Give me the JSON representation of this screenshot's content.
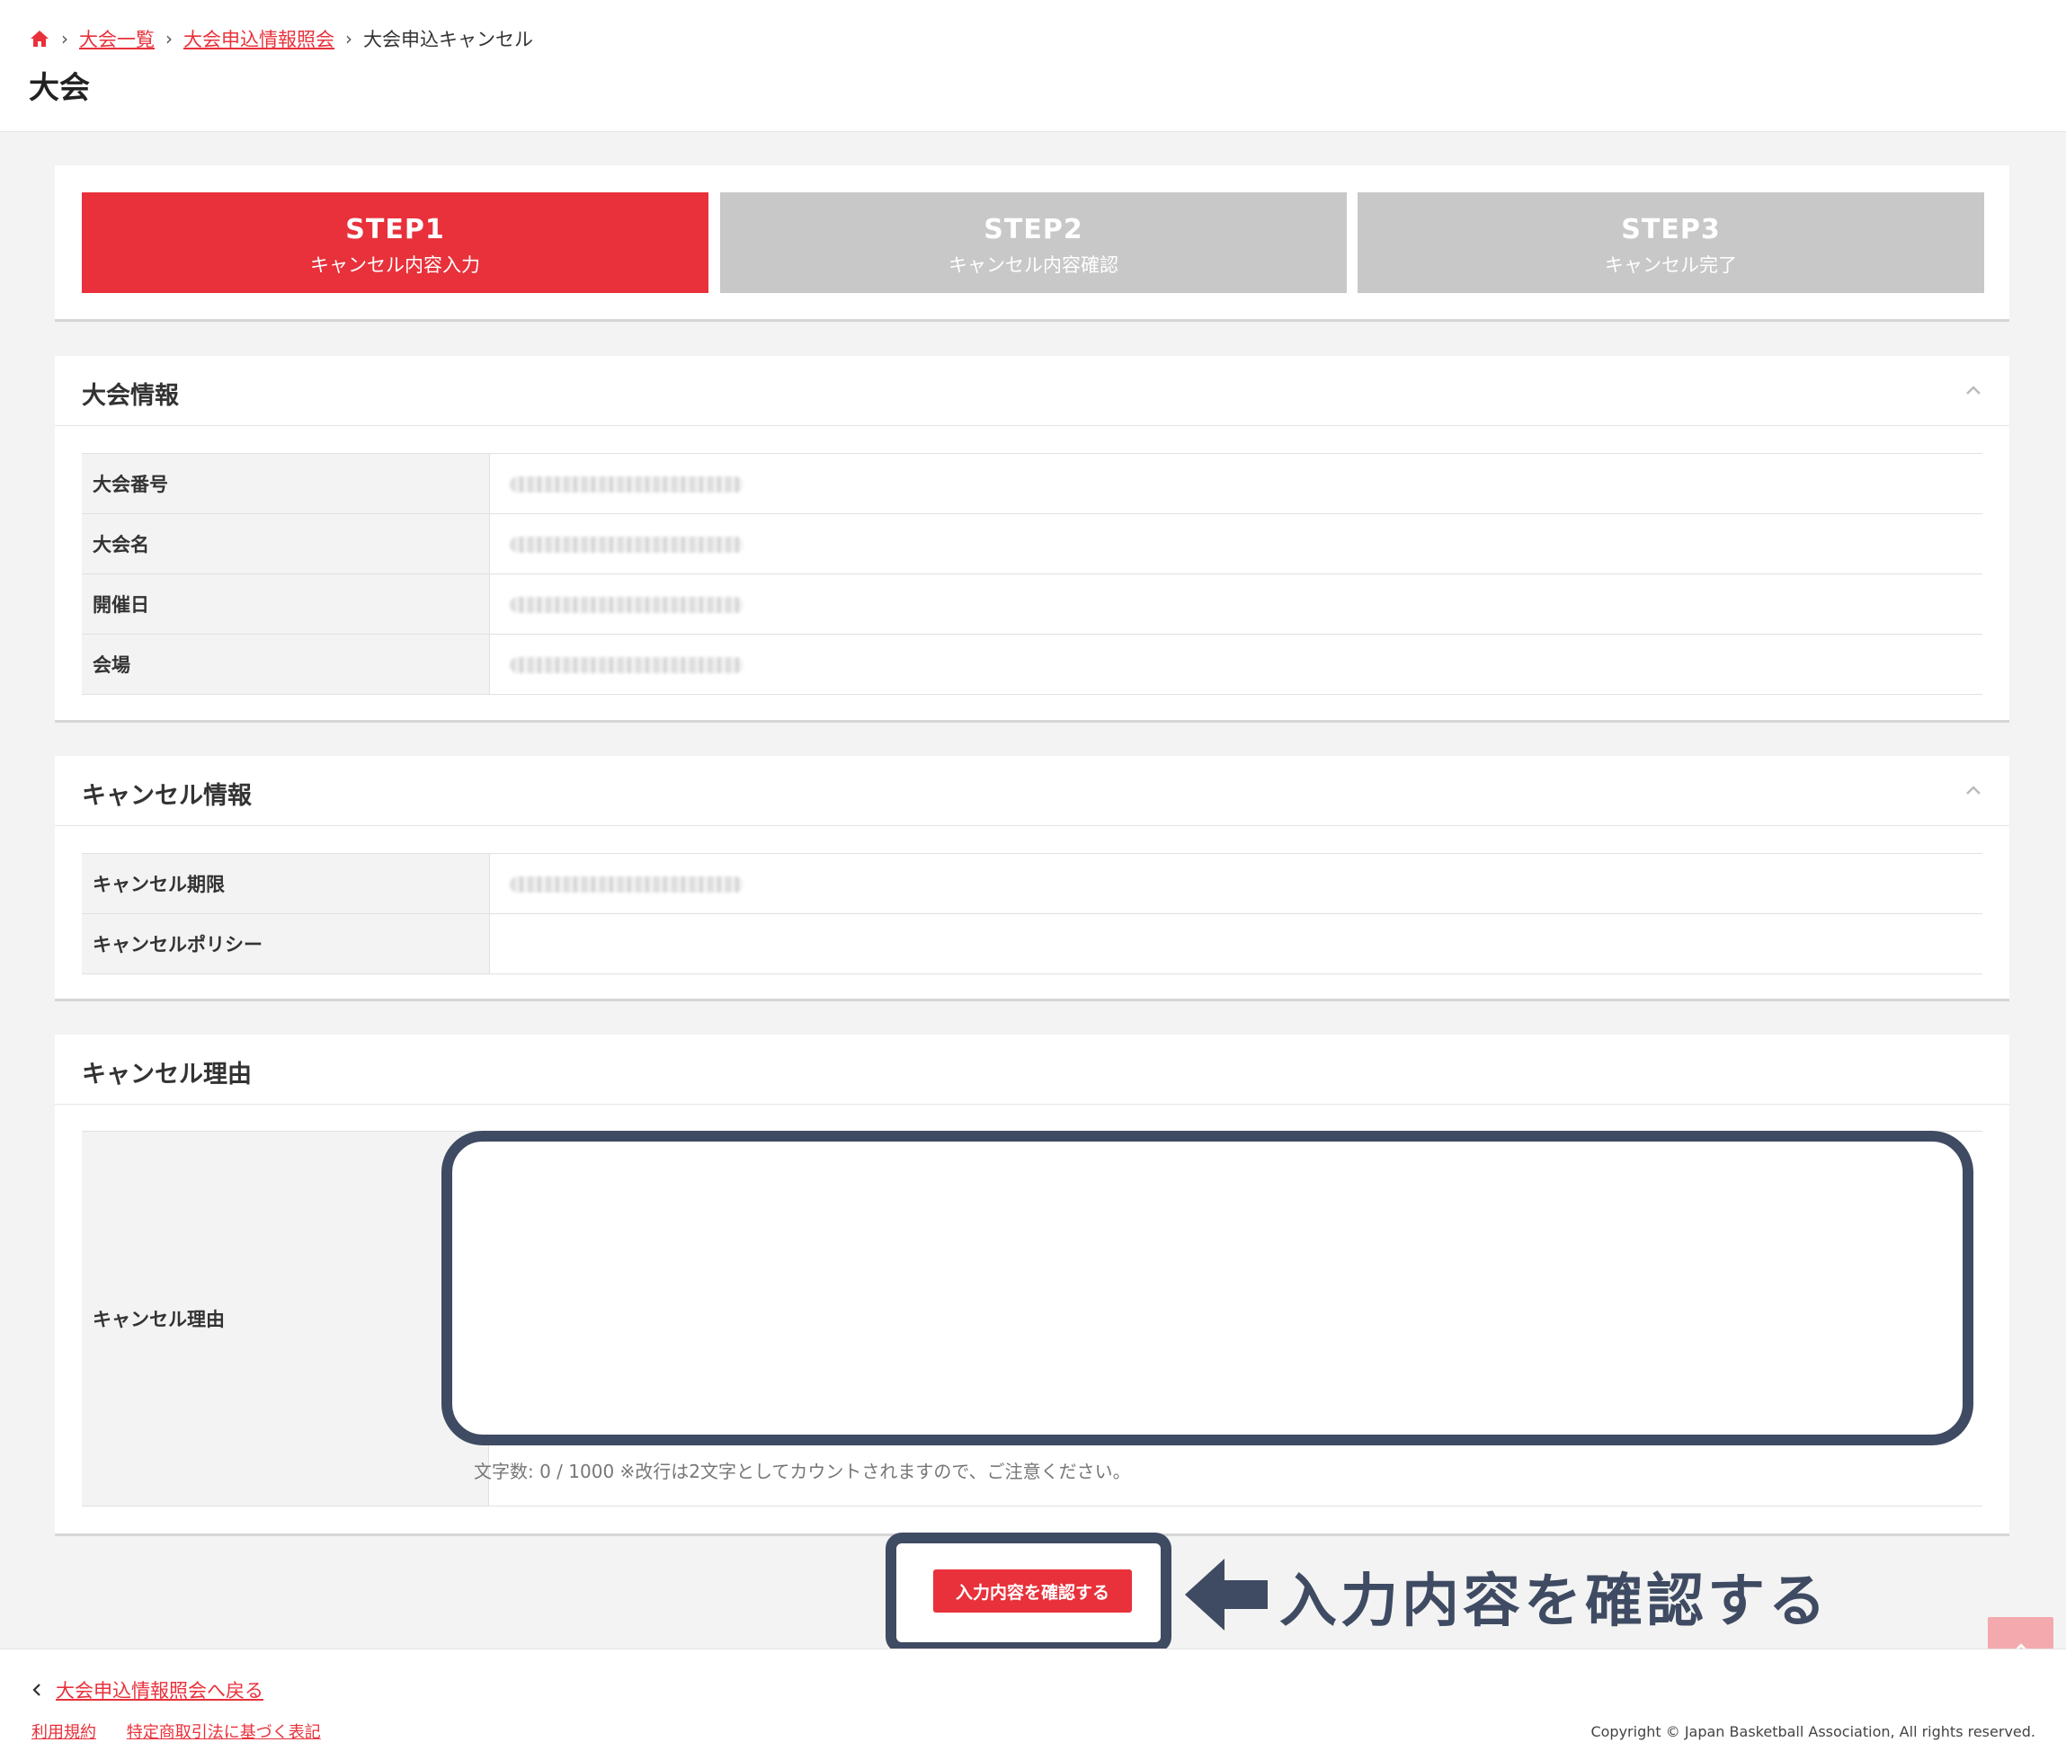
{
  "breadcrumb": {
    "home_icon": "home-icon",
    "items": [
      "大会一覧",
      "大会申込情報照会"
    ],
    "current": "大会申込キャンセル"
  },
  "page": {
    "title": "大会"
  },
  "steps": [
    {
      "num": "STEP1",
      "label": "キャンセル内容入力",
      "active": true
    },
    {
      "num": "STEP2",
      "label": "キャンセル内容確認",
      "active": false
    },
    {
      "num": "STEP3",
      "label": "キャンセル完了",
      "active": false
    }
  ],
  "tournament_info": {
    "title": "大会情報",
    "rows": [
      {
        "label": "大会番号"
      },
      {
        "label": "大会名"
      },
      {
        "label": "開催日"
      },
      {
        "label": "会場"
      }
    ]
  },
  "cancel_info": {
    "title": "キャンセル情報",
    "rows": [
      {
        "label": "キャンセル期限"
      },
      {
        "label": "キャンセルポリシー"
      }
    ]
  },
  "cancel_reason": {
    "title": "キャンセル理由",
    "label": "キャンセル理由",
    "value": "",
    "char_count": "文字数: 0 / 1000 ※改行は2文字としてカウントされますので、ご注意ください。"
  },
  "actions": {
    "confirm_label": "入力内容を確認する",
    "annotation": "入力内容を確認する"
  },
  "footer": {
    "back_label": "大会申込情報照会へ戻る",
    "links": [
      "利用規約",
      "特定商取引法に基づく表記"
    ],
    "copyright": "Copyright © Japan Basketball Association, All rights reserved."
  },
  "colors": {
    "accent": "#e8313b",
    "inactive_step": "#c8c8c8",
    "annotation": "#3f4b62"
  }
}
